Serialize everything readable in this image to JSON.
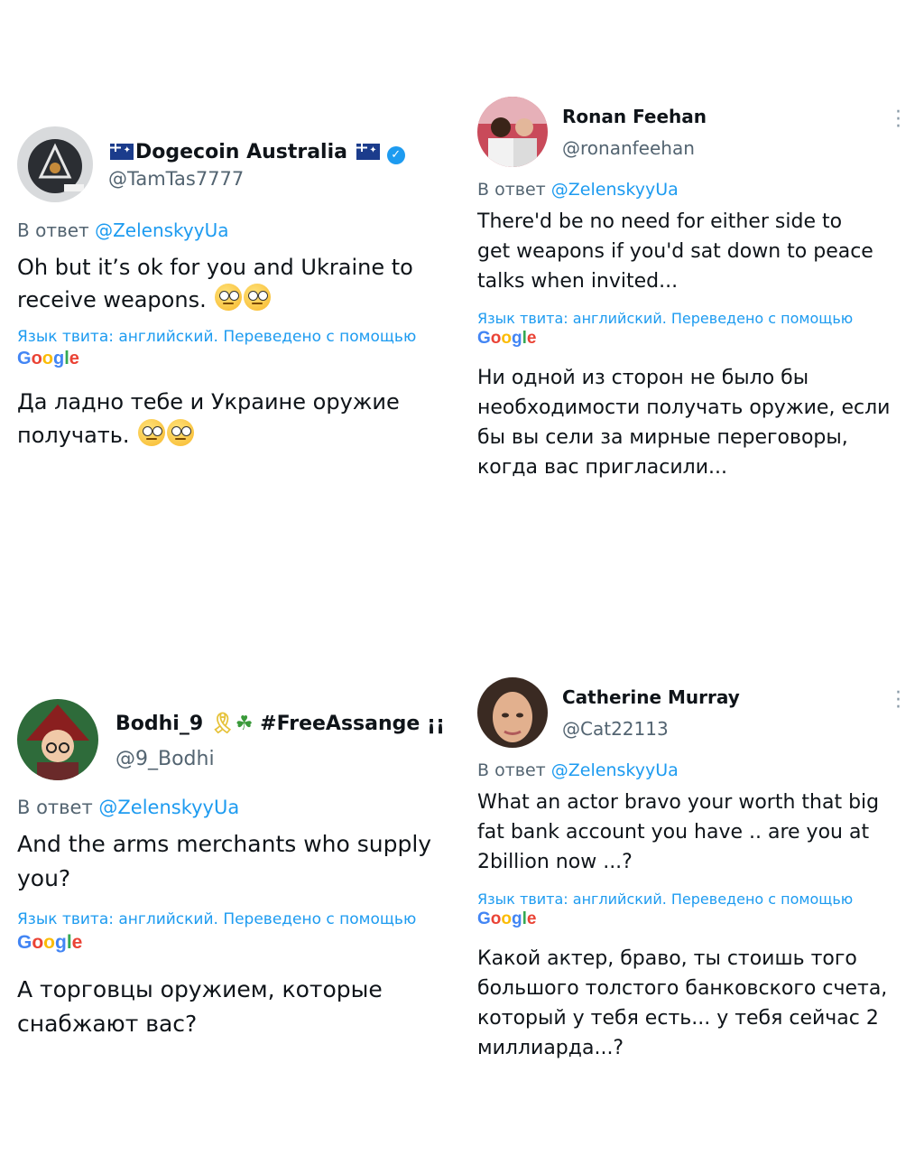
{
  "tweets": [
    {
      "name": "Dogecoin Australia",
      "handle": "@TamTas7777",
      "reply_prefix": "В ответ",
      "reply_mention": "@ZelenskyyUa",
      "text_line1": "Oh but it’s ok for you and Ukraine to",
      "text_line2": "receive weapons.",
      "translation_note": "Язык твита: английский. Переведено с помощью",
      "translated_line1": "Да ладно тебе и Украине оружие",
      "translated_line2": "получать."
    },
    {
      "name": "Ronan Feehan",
      "handle": "@ronanfeehan",
      "reply_prefix": "В ответ",
      "reply_mention": "@ZelenskyyUa",
      "text_line1": "There'd be no need for either side to",
      "text_line2": "get weapons if you'd sat down to peace",
      "text_line3": "talks when invited...",
      "translation_note": "Язык твита: английский. Переведено с помощью",
      "translated_line1": "Ни одной из сторон не было бы",
      "translated_line2": "необходимости получать оружие, если",
      "translated_line3": "бы вы сели за мирные переговоры,",
      "translated_line4": "когда вас пригласили..."
    },
    {
      "name": "Bodhi_9",
      "name_tag": "#FreeAssange ¡¡",
      "handle": "@9_Bodhi",
      "reply_prefix": "В ответ",
      "reply_mention": "@ZelenskyyUa",
      "text_line1": "And the arms merchants who supply",
      "text_line2": "you?",
      "translation_note": "Язык твита: английский. Переведено с помощью",
      "translated_line1": "А торговцы оружием, которые",
      "translated_line2": "снабжают вас?"
    },
    {
      "name": "Catherine Murray",
      "handle": "@Cat22113",
      "reply_prefix": "В ответ",
      "reply_mention": "@ZelenskyyUa",
      "text_line1": "What an actor bravo your worth that big",
      "text_line2": "fat bank account you have .. are you at",
      "text_line3": "2billion now ...?",
      "translation_note": "Язык твита: английский. Переведено с помощью",
      "translated_line1": "Какой актер, браво, ты стоишь того",
      "translated_line2": "большого толстого банковского счета,",
      "translated_line3": "который у тебя есть... у тебя сейчас 2",
      "translated_line4": "миллиарда...?"
    }
  ],
  "google_logo": "Google",
  "colors": {
    "mention": "#1d9bf0",
    "secondary_text": "#536471",
    "verified": "#1d9bf0"
  },
  "icons": [
    "more-icon",
    "verified-badge-icon",
    "australia-flag-icon",
    "eye-roll-emoji-icon",
    "yellow-ribbon-icon",
    "shamrock-icon"
  ]
}
